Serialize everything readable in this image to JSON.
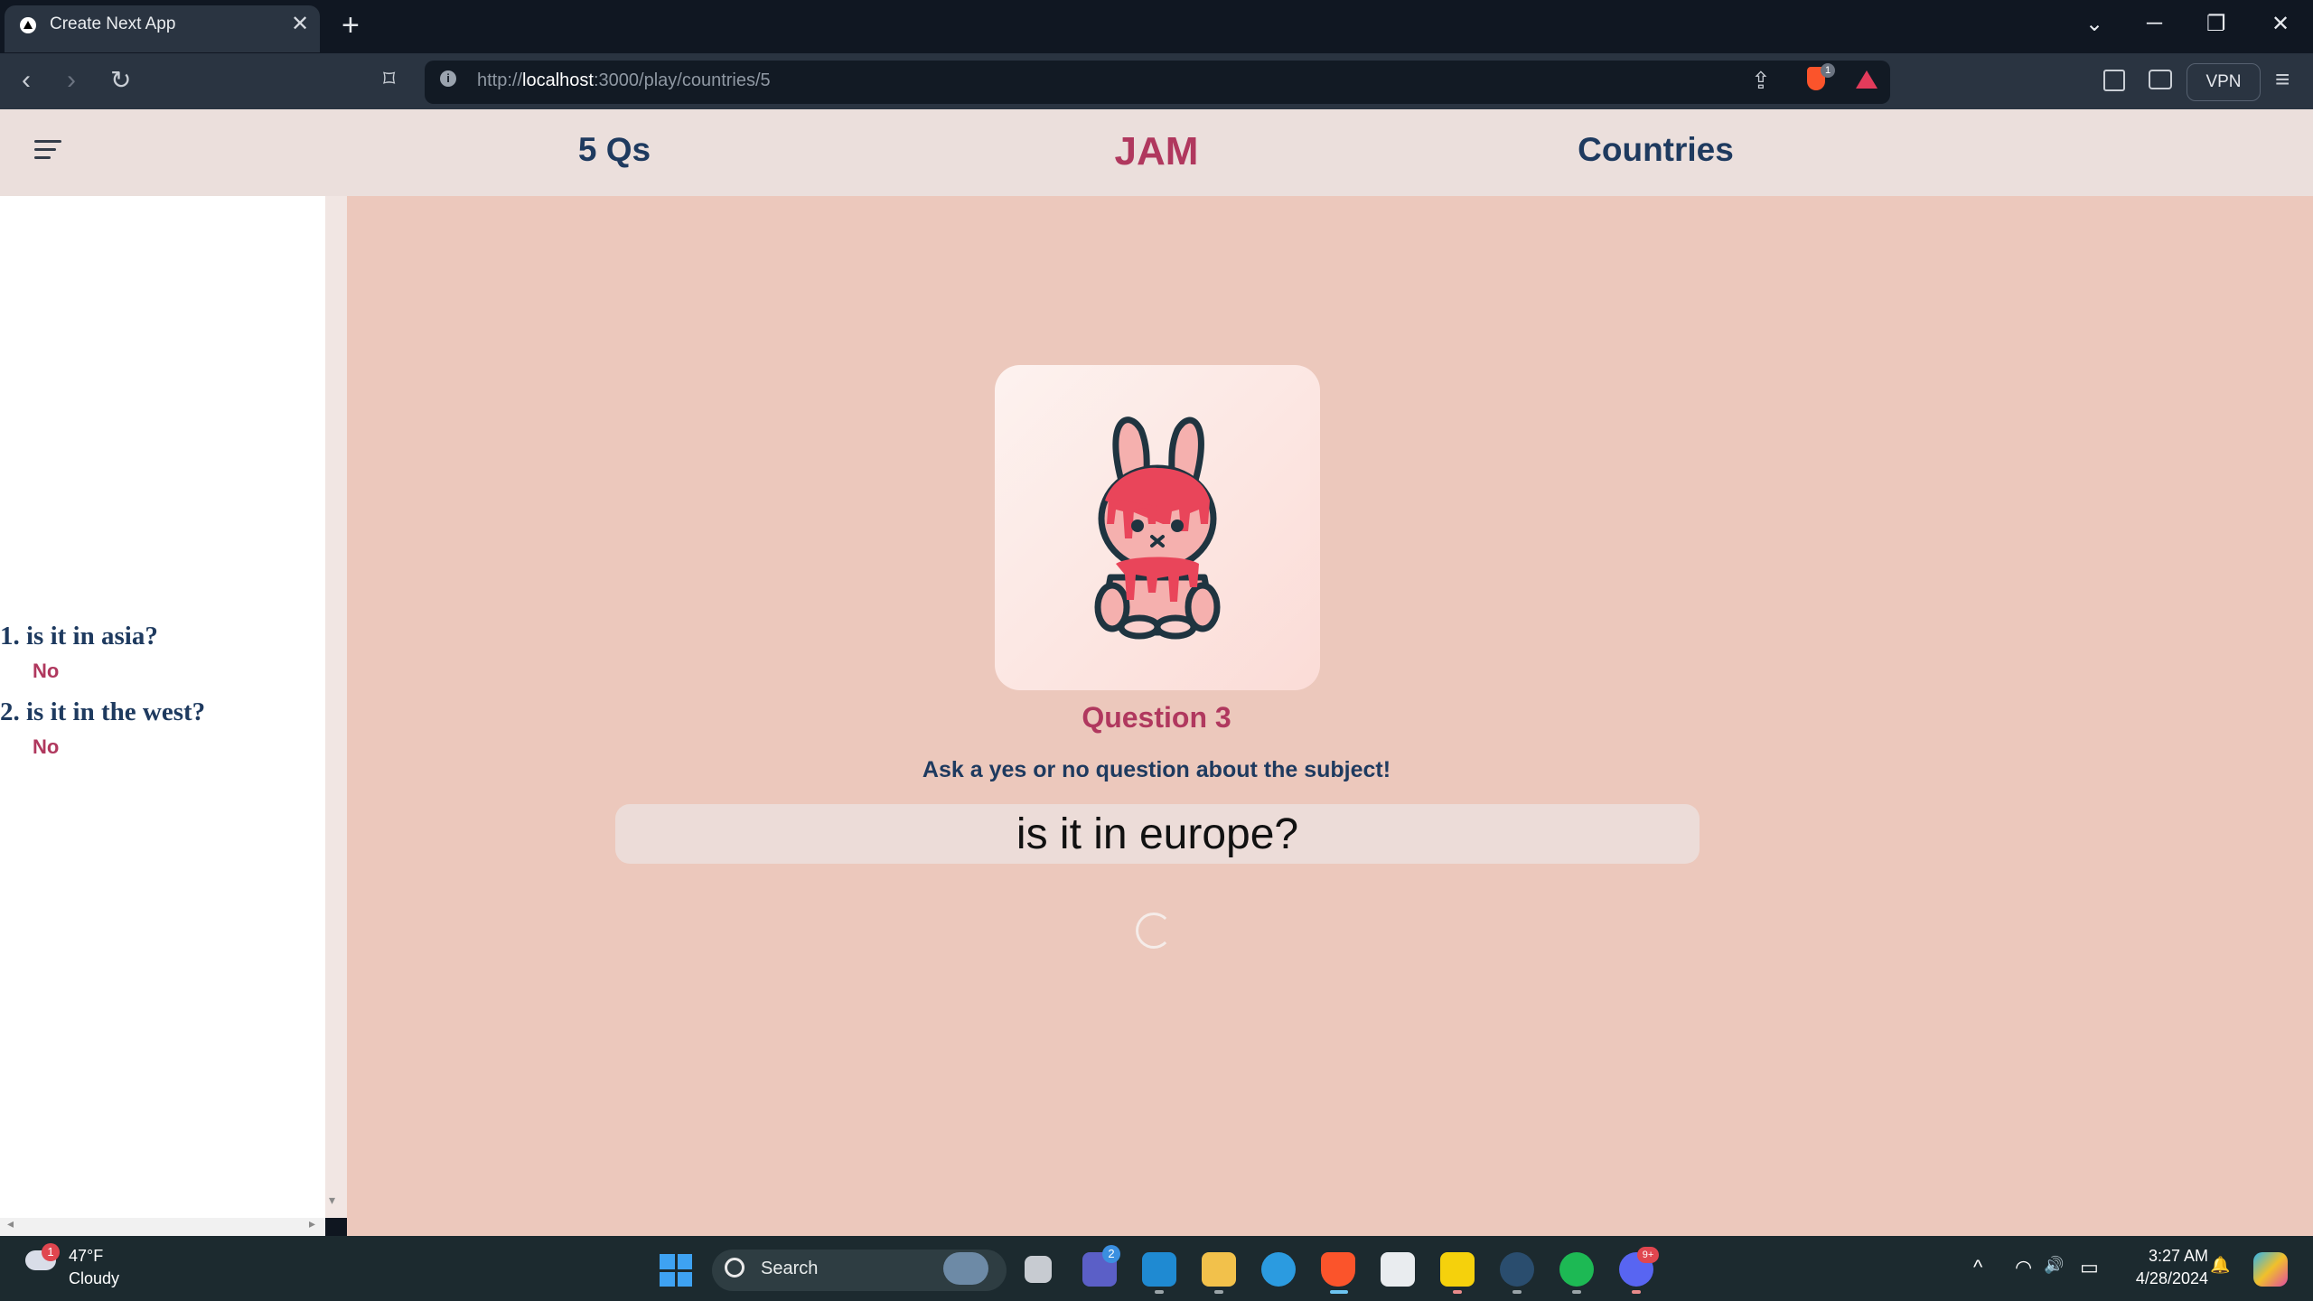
{
  "browser": {
    "tab_title": "Create Next App",
    "tab_close": "✕",
    "new_tab": "+",
    "window_controls": {
      "tab_search": "⌄",
      "minimize": "─",
      "restore": "❐",
      "close": "✕"
    },
    "url_prefix": "http://",
    "url_host": "localhost",
    "url_rest": ":3000/play/countries/5",
    "info_glyph": "i",
    "shields_count": "1",
    "vpn_label": "VPN",
    "nav": {
      "back": "‹",
      "forward": "›",
      "reload": "↻",
      "bookmark": "⌑",
      "share": "⇪",
      "menu": "≡"
    }
  },
  "app": {
    "count_label": "5 Qs",
    "brand": "JAM",
    "category": "Countries",
    "history": [
      {
        "question": "1. is it in asia?",
        "answer": "No"
      },
      {
        "question": "2. is it in the west?",
        "answer": "No"
      }
    ],
    "question_heading": "Question 3",
    "prompt": "Ask a yes or no question about the subject!",
    "input_value": "is it in europe?",
    "scroll_arrows": {
      "left": "◂",
      "right": "▸",
      "down": "▾"
    }
  },
  "taskbar": {
    "weather_temp": "47°F",
    "weather_condition": "Cloudy",
    "weather_badge": "1",
    "search_label": "Search",
    "teams_badge": "2",
    "discord_badge": "9+",
    "tray": {
      "overflow": "^",
      "wifi": "◠",
      "volume": "🔊",
      "battery": "▭",
      "bell": "🔔"
    },
    "clock_time": "3:27 AM",
    "clock_date": "4/28/2024"
  },
  "colors": {
    "brand": "#b0385e",
    "navy": "#1e3a5f",
    "header_bg": "#ebdfdc",
    "main_bg": "#ecc8bc"
  }
}
